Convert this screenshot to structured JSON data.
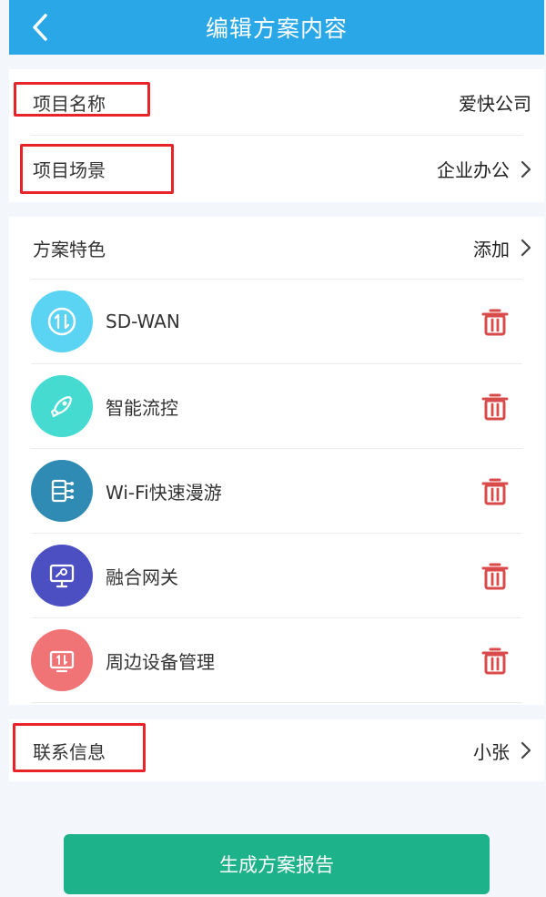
{
  "header": {
    "title": "编辑方案内容"
  },
  "project": {
    "name_label": "项目名称",
    "name_value": "爱快公司",
    "scene_label": "项目场景",
    "scene_value": "企业办公"
  },
  "features": {
    "label": "方案特色",
    "add_label": "添加",
    "items": [
      {
        "name": "SD-WAN",
        "color": "#5bd3f2",
        "icon": "sdwan-icon"
      },
      {
        "name": "智能流控",
        "color": "#45dbd0",
        "icon": "rocket-icon"
      },
      {
        "name": "Wi-Fi快速漫游",
        "color": "#2f8ab4",
        "icon": "server-icon"
      },
      {
        "name": "融合网关",
        "color": "#4b4fc2",
        "icon": "monitor-icon"
      },
      {
        "name": "周边设备管理",
        "color": "#f07375",
        "icon": "device-icon"
      }
    ]
  },
  "contact": {
    "label": "联系信息",
    "value": "小张"
  },
  "submit": {
    "label": "生成方案报告"
  }
}
